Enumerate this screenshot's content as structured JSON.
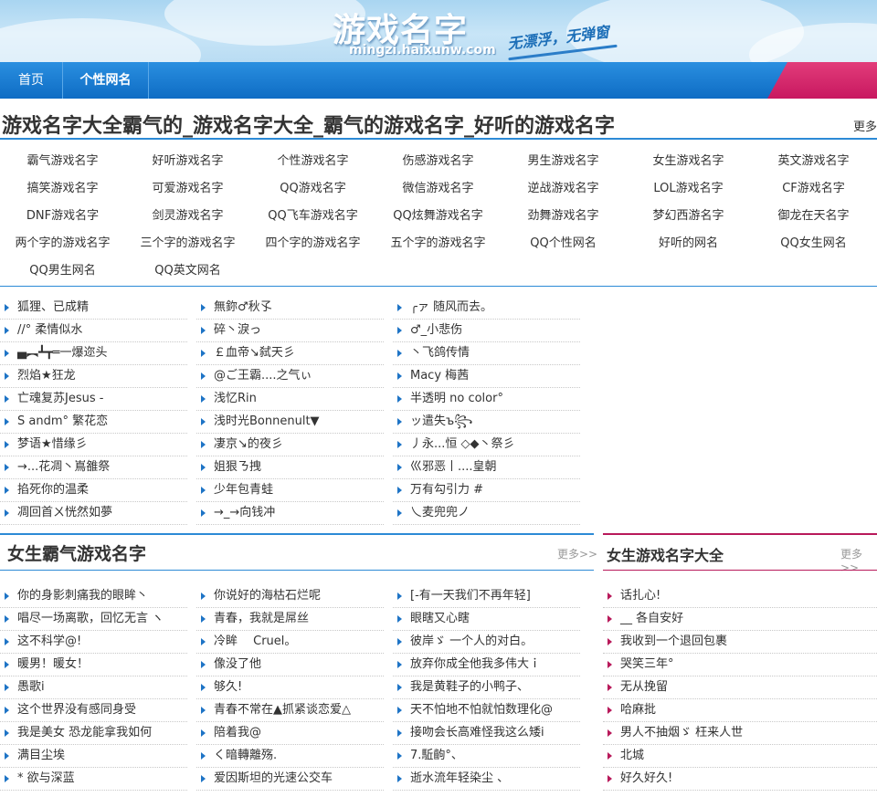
{
  "header": {
    "logo_title": "游戏名字",
    "logo_domain": "mingzi.haixunw.com",
    "slogan": "无漂浮，无弹窗"
  },
  "nav": {
    "items": [
      {
        "label": "首页"
      },
      {
        "label": "个性网名"
      }
    ],
    "accent_color": "#d6246a"
  },
  "main": {
    "title": "游戏名字大全霸气的_游戏名字大全_霸气的游戏名字_好听的游戏名字",
    "more": "更多"
  },
  "categories": [
    "霸气游戏名字",
    "好听游戏名字",
    "个性游戏名字",
    "伤感游戏名字",
    "男生游戏名字",
    "女生游戏名字",
    "英文游戏名字",
    "搞笑游戏名字",
    "可爱游戏名字",
    "QQ游戏名字",
    "微信游戏名字",
    "逆战游戏名字",
    "LOL游戏名字",
    "CF游戏名字",
    "DNF游戏名字",
    "剑灵游戏名字",
    "QQ飞车游戏名字",
    "QQ炫舞游戏名字",
    "劲舞游戏名字",
    "梦幻西游名字",
    "御龙在天名字",
    "两个字的游戏名字",
    "三个字的游戏名字",
    "四个字的游戏名字",
    "五个字的游戏名字",
    "QQ个性网名",
    "好听的网名",
    "QQ女生网名",
    "QQ男生网名",
    "QQ英文网名"
  ],
  "name_columns": [
    [
      "狐狸、已成精",
      "//° 柔情似水",
      "▄︻┻┳═一爆迩头",
      "烈焰★狂龙",
      "亡魂复苏Jesus -",
      "S andm° 繁花恋",
      "梦语★惜缘彡",
      "→...花凋丶嶌雒祭",
      "掐死你的温柔",
      "凋回首ㄨ恍然如夢"
    ],
    [
      "無鉨♂秋孓",
      "碎丶淚っ",
      "￡血帝↘弑天彡",
      "@ご王霸....之气ぃ",
      "浅忆Rin",
      "浅时光Bonnenult▼",
      "凄京↘的夜彡",
      "姐狠ㄋ拽",
      "少年包青蛙",
      "→_→向钱冲"
    ],
    [
      "╭ァ 随风而去。",
      "♂_小悲伤",
      "丶飞鸽传情",
      "Macy 梅茜",
      "半透明 no color°",
      "ッ遣失ъ꧂",
      "丿永...恒 ◇◆丶祭彡",
      "巛邪恶丨....皇朝",
      "万有勾引力 #",
      "乀麦兜兜ノ"
    ]
  ],
  "female_section": {
    "title": "女生霸气游戏名字",
    "more": "更多>>",
    "columns": [
      [
        "你的身影刺痛我的眼眸丶",
        "唱尽一场离歌，回忆无言 ヽ",
        "这不科学@!",
        "暖男！暖女！",
        "愚歌i",
        "这个世界没有感同身受",
        "我是美女 恐龙能拿我如何",
        "满目尘埃",
        "* 欲与深蓝"
      ],
      [
        "你说好的海枯石烂呢",
        "青春，我就是屌丝",
        "冷眸　 Cruel。",
        "像没了他",
        "够久!",
        "青春不常在▲抓紧谈恋爱△",
        "陪着我@",
        "く暗轉離殇.",
        "爱因斯坦的光速公交车"
      ],
      [
        "[-有一天我们不再年轻]",
        "眼瞎又心瞎",
        "彼岸ゞ 一个人的对白。",
        "放弃你成全他我多伟大ｉ",
        "我是黄鞋子的小鸭子、",
        "天不怕地不怕就怕数理化@",
        "接吻会长高难怪我这么矮i",
        "7.駈齣°、",
        "逝水流年轻染尘 、"
      ]
    ]
  },
  "female_all_section": {
    "title": "女生游戏名字大全",
    "more": "更多>>",
    "items": [
      "话扎心!",
      "__ 各自安好",
      "我收到一个退回包裹",
      "哭笑三年°",
      "无从挽留",
      "哈麻批",
      "男人不抽烟ゞ 枉来人世",
      "北城",
      "好久好久!"
    ]
  },
  "colors": {
    "blue": "#2c8ad6",
    "pink": "#b8195a",
    "bullet_blue": "#1e74c6"
  }
}
